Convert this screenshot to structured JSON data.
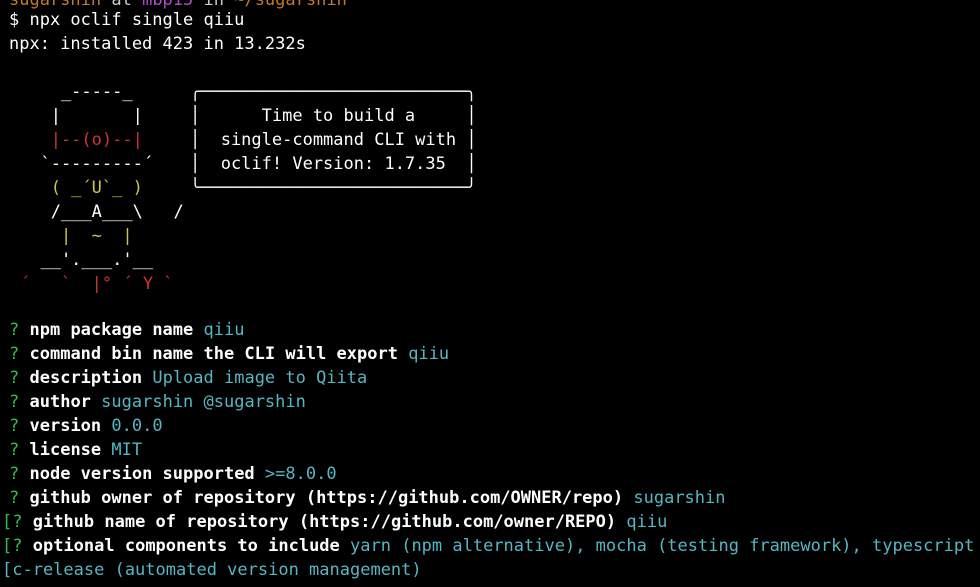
{
  "colors": {
    "background": "#000000",
    "text": "#ffffff",
    "question_mark": "#2fbf4a",
    "answer": "#56b6c2",
    "ascii_red": "#cc3333",
    "ascii_yellow": "#c8c84a"
  },
  "top_cut_line": {
    "user": "sugarshin",
    "at": " at ",
    "host": "mbp15",
    "in": " in ",
    "path": "~/sugarshin"
  },
  "commands": [
    "$ npx oclif single qiiu",
    "npx: installed 423 in 13.232s"
  ],
  "ascii_art": {
    "lines": [
      "    _-----_",
      "   |       |",
      "   |--(o)--|",
      "  `---------´",
      "   ( _´U`_ )",
      "   /___A___\\   /",
      "    |  ~  |",
      "  __'.___.'__",
      "´   `  |° ´ Y `"
    ]
  },
  "banner": {
    "top": "╭──────────────────────────╮",
    "lines": [
      "│      Time to build a     │",
      "│  single-command CLI with │",
      "│  oclif! Version: 1.7.35  │"
    ],
    "bottom": "╰──────────────────────────╯"
  },
  "prompts": [
    {
      "mark": "?",
      "question": "npm package name",
      "answer": "qiiu"
    },
    {
      "mark": "?",
      "question": "command bin name the CLI will export",
      "answer": "qiiu"
    },
    {
      "mark": "?",
      "question": "description",
      "answer": "Upload image to Qiita"
    },
    {
      "mark": "?",
      "question": "author",
      "answer": "sugarshin @sugarshin"
    },
    {
      "mark": "?",
      "question": "version",
      "answer": "0.0.0"
    },
    {
      "mark": "?",
      "question": "license",
      "answer": "MIT"
    },
    {
      "mark": "?",
      "question": "node version supported",
      "answer": ">=8.0.0"
    },
    {
      "mark": "?",
      "question": "github owner of repository (https://github.com/OWNER/repo)",
      "answer": "sugarshin"
    },
    {
      "mark": "[?",
      "question": "github name of repository (https://github.com/owner/REPO)",
      "answer": "qiiu"
    },
    {
      "mark": "[?",
      "question": "optional components to include",
      "answer": "yarn (npm alternative), mocha (testing framework), typescript"
    }
  ],
  "wrap_line": "[c-release (automated version management)"
}
